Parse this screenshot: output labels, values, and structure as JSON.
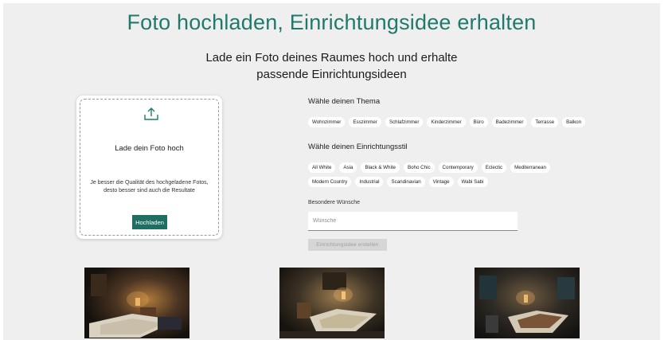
{
  "header": {
    "title": "Foto hochladen, Einrichtungsidee erhalten",
    "subtitle_line1": "Lade ein Foto deines Raumes hoch und erhalte",
    "subtitle_line2": "passende Einrichtungsideen"
  },
  "upload": {
    "icon": "upload-icon",
    "label": "Lade dein Foto hoch",
    "hint": "Je besser die Qualität des hochgeladene Fotos, desto besser sind auch die Resultate",
    "button_label": "Hochladen"
  },
  "theme": {
    "heading": "Wähle deinen Thema",
    "options": [
      "Wohnzimmer",
      "Esszimmer",
      "Schlafzimmer",
      "Kinderzimmer",
      "Büro",
      "Badezimmer",
      "Terrasse",
      "Balkon"
    ]
  },
  "style": {
    "heading": "Wähle deinen Einrichtungsstil",
    "options": [
      "All White",
      "Asia",
      "Black & White",
      "Boho Chic",
      "Contemporary",
      "Eclectic",
      "Mediterranean",
      "Modern Country",
      "Industrial",
      "Scandinavian",
      "Vintage",
      "Wabi Sabi"
    ]
  },
  "wishes": {
    "label": "Besondere Wünsche",
    "placeholder": "Wünsche"
  },
  "create": {
    "button_label": "Einrichtungsidee erstellen"
  },
  "colors": {
    "accent": "#1f7a6d",
    "button": "#1f6e64",
    "background": "#efefef"
  }
}
